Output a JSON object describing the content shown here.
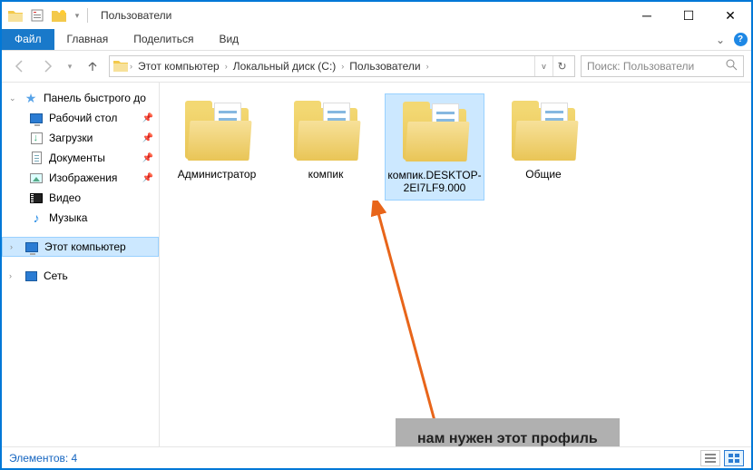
{
  "window": {
    "title": "Пользователи"
  },
  "ribbon": {
    "file": "Файл",
    "tabs": [
      "Главная",
      "Поделиться",
      "Вид"
    ]
  },
  "breadcrumb": [
    "Этот компьютер",
    "Локальный диск (C:)",
    "Пользователи"
  ],
  "search": {
    "placeholder": "Поиск: Пользователи"
  },
  "sidebar": {
    "quick_access": "Панель быстрого до",
    "items": [
      {
        "label": "Рабочий стол",
        "pinned": true
      },
      {
        "label": "Загрузки",
        "pinned": true
      },
      {
        "label": "Документы",
        "pinned": true
      },
      {
        "label": "Изображения",
        "pinned": true
      },
      {
        "label": "Видео",
        "pinned": false
      },
      {
        "label": "Музыка",
        "pinned": false
      }
    ],
    "this_pc": "Этот компьютер",
    "network": "Сеть"
  },
  "folders": [
    {
      "name": "Администратор",
      "selected": false
    },
    {
      "name": "компик",
      "selected": false
    },
    {
      "name": "компик.DESKTOP-2EI7LF9.000",
      "selected": true
    },
    {
      "name": "Общие",
      "selected": false
    }
  ],
  "status": {
    "text": "Элементов: 4"
  },
  "annotation": {
    "caption": "нам нужен этот профиль"
  }
}
